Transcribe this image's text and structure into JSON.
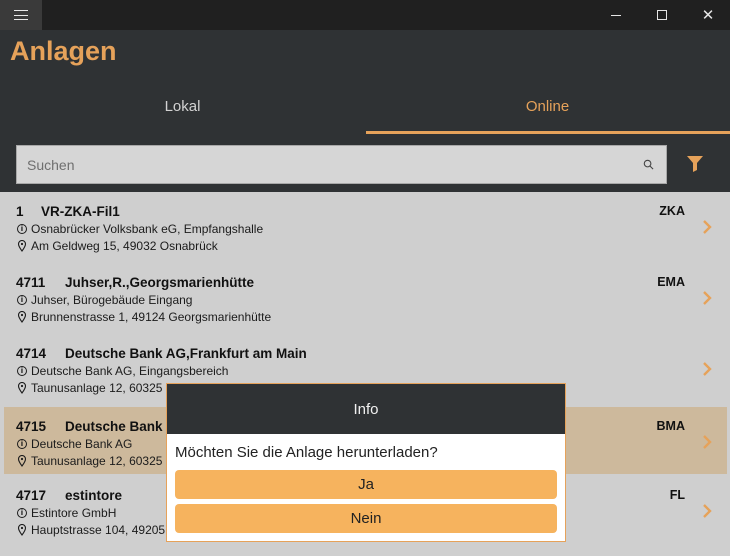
{
  "window": {
    "title": "Anlagen"
  },
  "tabs": [
    {
      "label": "Lokal",
      "active": false
    },
    {
      "label": "Online",
      "active": true
    }
  ],
  "search": {
    "placeholder": "Suchen",
    "value": ""
  },
  "colors": {
    "accent": "#e6a25a",
    "header_bg": "#2f3234",
    "selected_row": "#cdb99c",
    "button": "#f6b35e"
  },
  "items": [
    {
      "id": "1",
      "name": "VR-ZKA-Fil1",
      "code": "ZKA",
      "info": "Osnabrücker Volksbank eG, Empfangshalle",
      "address": "Am Geldweg 15, 49032 Osnabrück",
      "selected": false
    },
    {
      "id": "4711",
      "name": "Juhser,R.,Georgsmarienhütte",
      "code": "EMA",
      "info": "Juhser, Bürogebäude Eingang",
      "address": "Brunnenstrasse 1, 49124 Georgsmarienhütte",
      "selected": false
    },
    {
      "id": "4714",
      "name": "Deutsche Bank AG,Frankfurt am Main",
      "code": "",
      "info": "Deutsche Bank AG, Eingangsbereich",
      "address": "Taunusanlage 12, 60325 F",
      "selected": false
    },
    {
      "id": "4715",
      "name": "Deutsche Bank",
      "code": "BMA",
      "info": "Deutsche Bank AG",
      "address": "Taunusanlage 12, 60325 F",
      "selected": true
    },
    {
      "id": "4717",
      "name": "estintore",
      "code": "FL",
      "info": "Estintore GmbH",
      "address": "Hauptstrasse 104, 49205 F",
      "selected": false
    }
  ],
  "dialog": {
    "title": "Info",
    "message": "Möchten Sie die Anlage herunterladen?",
    "confirm_label": "Ja",
    "cancel_label": "Nein"
  }
}
